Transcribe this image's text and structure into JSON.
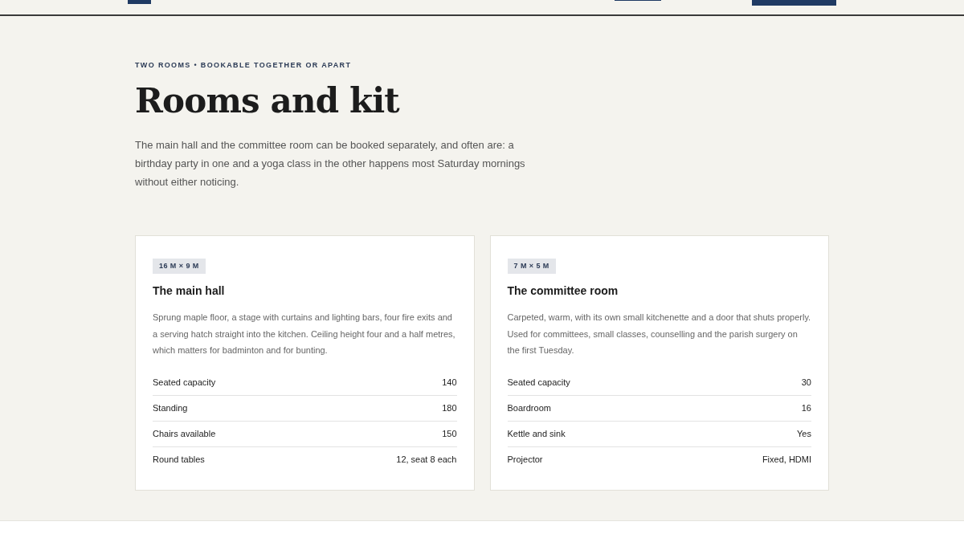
{
  "section": {
    "eyebrow": "TWO ROOMS • BOOKABLE TOGETHER OR APART",
    "title": "Rooms and kit",
    "intro": "The main hall and the committee room can be booked separately, and often are: a birthday party in one and a yoga class in the other happens most Saturday mornings without either noticing."
  },
  "rooms": [
    {
      "size": "16 M × 9 M",
      "name": "The main hall",
      "description": "Sprung maple floor, a stage with curtains and lighting bars, four fire exits and a serving hatch straight into the kitchen. Ceiling height four and a half metres, which matters for badminton and for bunting.",
      "specs": [
        {
          "label": "Seated capacity",
          "value": "140"
        },
        {
          "label": "Standing",
          "value": "180"
        },
        {
          "label": "Chairs available",
          "value": "150"
        },
        {
          "label": "Round tables",
          "value": "12, seat 8 each"
        }
      ]
    },
    {
      "size": "7 M × 5 M",
      "name": "The committee room",
      "description": "Carpeted, warm, with its own small kitchenette and a door that shuts properly. Used for committees, small classes, counselling and the parish surgery on the first Tuesday.",
      "specs": [
        {
          "label": "Seated capacity",
          "value": "30"
        },
        {
          "label": "Boardroom",
          "value": "16"
        },
        {
          "label": "Kettle and sink",
          "value": "Yes"
        },
        {
          "label": "Projector",
          "value": "Fixed, HDMI"
        }
      ]
    }
  ]
}
